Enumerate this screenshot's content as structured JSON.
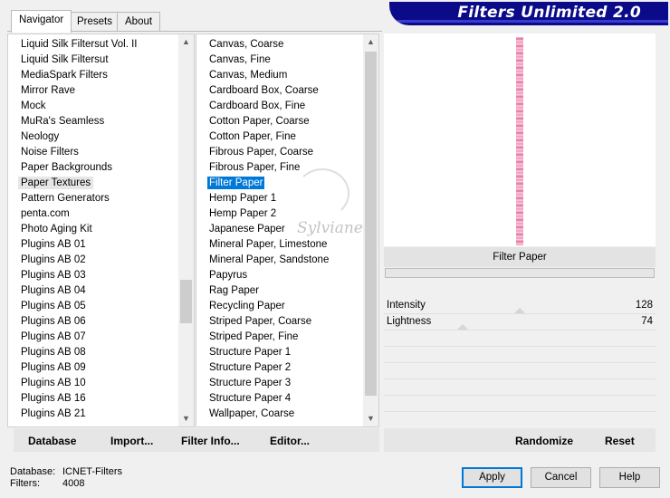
{
  "tabs": [
    {
      "label": "Navigator",
      "active": true
    },
    {
      "label": "Presets",
      "active": false
    },
    {
      "label": "About",
      "active": false
    }
  ],
  "banner_title": "Filters Unlimited 2.0",
  "categories": {
    "selected": "Paper Textures",
    "items": [
      "Liquid Silk Filtersut Vol. II",
      "Liquid Silk Filtersut",
      "MediaSpark Filters",
      "Mirror Rave",
      "Mock",
      "MuRa's Seamless",
      "Neology",
      "Noise Filters",
      "Paper Backgrounds",
      "Paper Textures",
      "Pattern Generators",
      "penta.com",
      "Photo Aging Kit",
      "Plugins AB 01",
      "Plugins AB 02",
      "Plugins AB 03",
      "Plugins AB 04",
      "Plugins AB 05",
      "Plugins AB 06",
      "Plugins AB 07",
      "Plugins AB 08",
      "Plugins AB 09",
      "Plugins AB 10",
      "Plugins AB 16",
      "Plugins AB 21"
    ]
  },
  "filters": {
    "selected": "Filter Paper",
    "items": [
      "Canvas, Coarse",
      "Canvas, Fine",
      "Canvas, Medium",
      "Cardboard Box, Coarse",
      "Cardboard Box, Fine",
      "Cotton Paper, Coarse",
      "Cotton Paper, Fine",
      "Fibrous Paper, Coarse",
      "Fibrous Paper, Fine",
      "Filter Paper",
      "Hemp Paper 1",
      "Hemp Paper 2",
      "Japanese Paper",
      "Mineral Paper, Limestone",
      "Mineral Paper, Sandstone",
      "Papyrus",
      "Rag Paper",
      "Recycling Paper",
      "Striped Paper, Coarse",
      "Striped Paper, Fine",
      "Structure Paper 1",
      "Structure Paper 2",
      "Structure Paper 3",
      "Structure Paper 4",
      "Wallpaper, Coarse"
    ]
  },
  "watermark_text": "Sylviane",
  "preview": {
    "filter_name": "Filter Paper"
  },
  "params": [
    {
      "label": "Intensity",
      "value": "128"
    },
    {
      "label": "Lightness",
      "value": "74"
    }
  ],
  "toolbar": {
    "database": "Database",
    "import": "Import...",
    "filter_info": "Filter Info...",
    "editor": "Editor...",
    "randomize": "Randomize",
    "reset": "Reset"
  },
  "footer": {
    "database_label": "Database:",
    "database_value": "ICNET-Filters",
    "filters_label": "Filters:",
    "filters_value": "4008"
  },
  "buttons": {
    "apply": "Apply",
    "cancel": "Cancel",
    "help": "Help"
  },
  "colors": {
    "selection": "#0078d7",
    "banner": "#0b0b8a"
  },
  "icons": {
    "up": "scroll-up-arrow-icon",
    "down": "scroll-down-arrow-icon"
  }
}
